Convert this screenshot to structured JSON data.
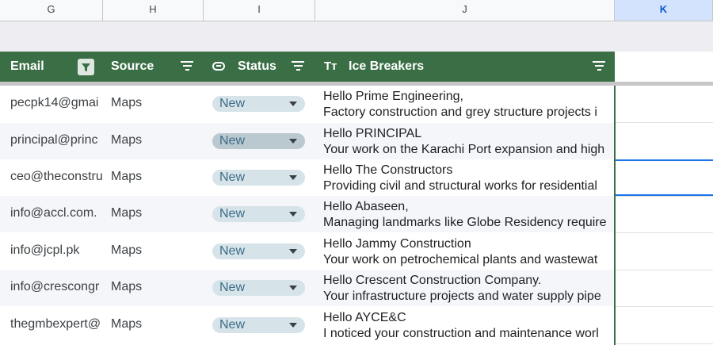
{
  "columns": [
    "G",
    "H",
    "I",
    "J",
    "K"
  ],
  "header": {
    "email": "Email",
    "source": "Source",
    "status": "Status",
    "ice": "Ice Breakers",
    "ice_icon_glyph": "Tт"
  },
  "colors": {
    "header_bg": "#3a6f46",
    "chip_bg": "#d6e4ea",
    "selected_col": "#d3e3fd"
  },
  "rows": [
    {
      "email": "pecpk14@gmai",
      "source": "Maps",
      "status": "New",
      "line1": "Hello Prime Engineering,",
      "line2": "Factory construction and grey structure projects i"
    },
    {
      "email": "principal@princ",
      "source": "Maps",
      "status": "New",
      "line1": "Hello PRINCIPAL",
      "line2": "Your work on the Karachi Port expansion and high"
    },
    {
      "email": "ceo@theconstru",
      "source": "Maps",
      "status": "New",
      "line1": "Hello The Constructors",
      "line2": "Providing civil and structural works for residential"
    },
    {
      "email": "info@accl.com.",
      "source": "Maps",
      "status": "New",
      "line1": "Hello Abaseen,",
      "line2": "Managing landmarks like Globe Residency require"
    },
    {
      "email": "info@jcpl.pk",
      "source": "Maps",
      "status": "New",
      "line1": "Hello Jammy Construction",
      "line2": "Your work on petrochemical plants and wastewat"
    },
    {
      "email": "info@crescongr",
      "source": "Maps",
      "status": "New",
      "line1": "Hello Crescent Construction Company.",
      "line2": "Your infrastructure projects and water supply pipe"
    },
    {
      "email": "thegmbexpert@",
      "source": "Maps",
      "status": "New",
      "line1": "Hello AYCE&C",
      "line2": "I noticed your construction and maintenance worl"
    }
  ]
}
